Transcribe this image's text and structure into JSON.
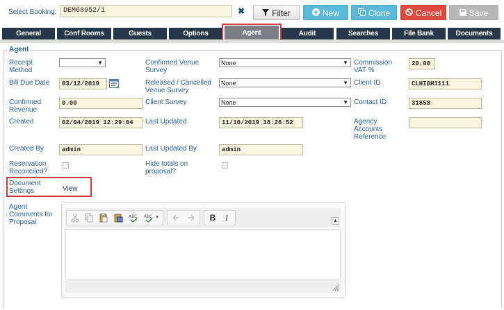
{
  "topbar": {
    "select_label": "Select Booking:",
    "booking_value": "DEM68952/1",
    "clear_glyph": "✖",
    "filter_label": "Filter",
    "new_label": "New",
    "clone_label": "Clone",
    "cancel_label": "Cancel",
    "save_label": "Save"
  },
  "tabs": [
    "General",
    "Conf Rooms",
    "Guests",
    "Options",
    "Agent",
    "Audit",
    "Searches",
    "File Bank",
    "Documents"
  ],
  "active_tab": "Agent",
  "section": {
    "legend": "Agent"
  },
  "fields": {
    "receipt_method": {
      "label": "Receipt Method",
      "value": ""
    },
    "confirmed_venue_survey": {
      "label": "Confirmed Venue Survey",
      "value": "None"
    },
    "commission_vat": {
      "label": "Commission VAT %",
      "value": "20.00"
    },
    "bill_due_date": {
      "label": "Bill Due Date",
      "value": "03/12/2019"
    },
    "released_cancelled_venue_survey": {
      "label": "Released / Cancelled Venue Survey",
      "value": "None"
    },
    "client_id": {
      "label": "Client ID",
      "value": "CLHIGH1111"
    },
    "confirmed_revenue": {
      "label": "Confirmed Revenue",
      "value": "0.00"
    },
    "client_survey": {
      "label": "Client Survey",
      "value": "None"
    },
    "contact_id": {
      "label": "Contact ID",
      "value": "31858"
    },
    "created": {
      "label": "Created",
      "value": "02/04/2019 12:29:04"
    },
    "last_updated": {
      "label": "Last Updated",
      "value": "11/10/2019 18:26:52"
    },
    "agency_accounts_reference": {
      "label": "Agency Accounts Reference",
      "value": ""
    },
    "created_by": {
      "label": "Created By",
      "value": "admin"
    },
    "last_updated_by": {
      "label": "Last Updated By",
      "value": "admin"
    },
    "reservation_reconciled": {
      "label": "Reservation Reconciled?",
      "checked": false
    },
    "hide_totals": {
      "label": "Hide totals on proposal?",
      "checked": false
    },
    "document_settings": {
      "label": "Document Settings",
      "link": "View"
    },
    "agent_comments": {
      "label": "Agent Comments for Proposal",
      "value": ""
    }
  },
  "editor_toolbar": {
    "bold": "B",
    "italic": "I"
  },
  "colors": {
    "tab_bg": "#24384a",
    "tab_active_bg": "#7c7f83",
    "highlight": "#d93a3a",
    "label_text": "#2a6090",
    "input_bg": "#fbf6df",
    "btn_info": "#5ab9d9",
    "btn_danger": "#dd4b3e",
    "btn_disabled": "#b8b8b8"
  }
}
